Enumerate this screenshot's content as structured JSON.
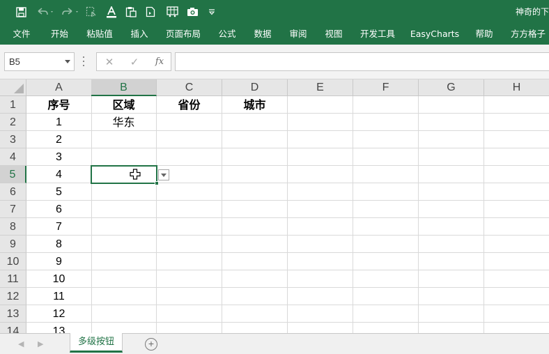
{
  "app": {
    "document_title": "神奇的下",
    "accent_color": "#217346"
  },
  "quick_access": [
    {
      "name": "save-icon"
    },
    {
      "name": "undo-icon"
    },
    {
      "name": "redo-icon"
    },
    {
      "name": "touch-mode-icon"
    },
    {
      "name": "font-color-icon"
    },
    {
      "name": "paste-icon"
    },
    {
      "name": "new-document-icon"
    },
    {
      "name": "form-icon"
    },
    {
      "name": "camera-icon"
    },
    {
      "name": "customize-qat-icon"
    }
  ],
  "ribbon": {
    "tabs": [
      "文件",
      "开始",
      "粘贴值",
      "插入",
      "页面布局",
      "公式",
      "数据",
      "审阅",
      "视图",
      "开发工具",
      "EasyCharts",
      "帮助",
      "方方格子"
    ]
  },
  "formula_bar": {
    "name_box": "B5",
    "cancel_symbol": "✕",
    "enter_symbol": "✓",
    "fx_label": "fx",
    "formula": ""
  },
  "grid": {
    "columns": [
      "A",
      "B",
      "C",
      "D",
      "E",
      "F",
      "G",
      "H"
    ],
    "rows": [
      "1",
      "2",
      "3",
      "4",
      "5",
      "6",
      "7",
      "8",
      "9",
      "10",
      "11",
      "12",
      "13",
      "14"
    ],
    "active_cell": "B5",
    "cells": {
      "A1": "序号",
      "B1": "区域",
      "C1": "省份",
      "D1": "城市",
      "A2": "1",
      "B2": "华东",
      "A3": "2",
      "A4": "3",
      "A5": "4",
      "A6": "5",
      "A7": "6",
      "A8": "7",
      "A9": "8",
      "A10": "9",
      "A11": "10",
      "A12": "11",
      "A13": "12",
      "A14": "13"
    },
    "bold_cells": [
      "A1",
      "B1",
      "C1",
      "D1"
    ]
  },
  "sheets": {
    "tabs": [
      "多级按钮"
    ],
    "active": "多级按钮",
    "add_symbol": "+"
  }
}
